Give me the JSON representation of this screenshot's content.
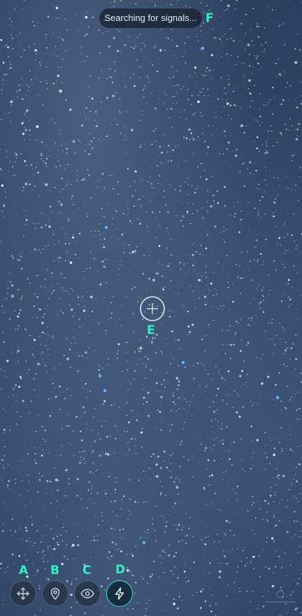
{
  "status": {
    "text": "Searching for signals..."
  },
  "markers": {
    "a": "A",
    "b": "B",
    "c": "C",
    "d": "D",
    "e": "E",
    "f": "F"
  },
  "toolbar": {
    "buttons": [
      {
        "id": "a",
        "icon": "move-arrows-icon",
        "active": false
      },
      {
        "id": "b",
        "icon": "location-pin-icon",
        "active": false
      },
      {
        "id": "c",
        "icon": "eye-icon",
        "active": false
      },
      {
        "id": "d",
        "icon": "lightning-bolt-icon",
        "active": true
      }
    ]
  },
  "colors": {
    "accent": "#2ff0c4",
    "sky": "#34496a",
    "pill_bg": "#1a2434"
  }
}
